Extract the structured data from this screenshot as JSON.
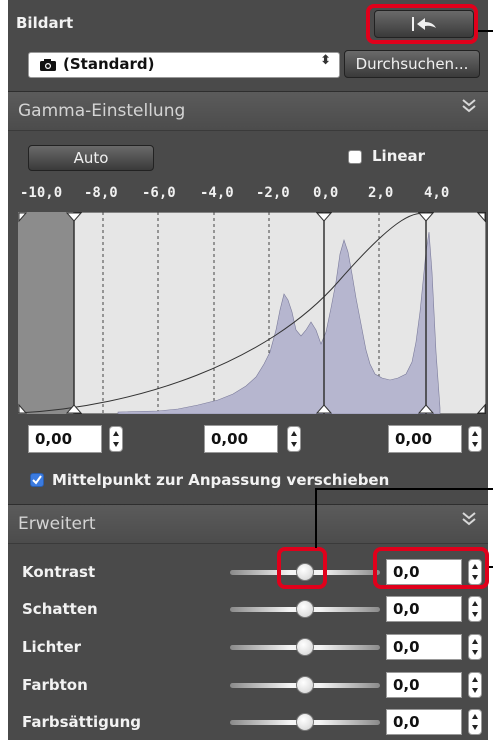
{
  "bildart": {
    "title": "Bildart",
    "selected": "(Standard)",
    "browse_label": "Durchsuchen..."
  },
  "gamma": {
    "title": "Gamma-Einstellung",
    "auto_label": "Auto",
    "linear_label": "Linear",
    "linear_checked": false,
    "ticks": [
      "-10,0",
      "-8,0",
      "-6,0",
      "-4,0",
      "-2,0",
      "0,0",
      "2,0",
      "4,0"
    ],
    "field_left": "0,00",
    "field_mid": "0,00",
    "field_right": "0,00",
    "midpoint_label": "Mittelpunkt zur Anpassung verschieben",
    "midpoint_checked": true
  },
  "erweitert": {
    "title": "Erweitert",
    "rows": [
      {
        "label": "Kontrast",
        "value": "0,0",
        "level": 0.5
      },
      {
        "label": "Schatten",
        "value": "0,0",
        "level": 0.5
      },
      {
        "label": "Lichter",
        "value": "0,0",
        "level": 0.5
      },
      {
        "label": "Farbton",
        "value": "0,0",
        "level": 0.5
      },
      {
        "label": "Farbsättigung",
        "value": "0,0",
        "level": 0.5
      }
    ]
  },
  "colors": {
    "panel": "#4a4a4a",
    "highlight": "#e0001b",
    "histogram_fill": "#b6b6cf",
    "checkbox_accent": "#3b7be0"
  }
}
